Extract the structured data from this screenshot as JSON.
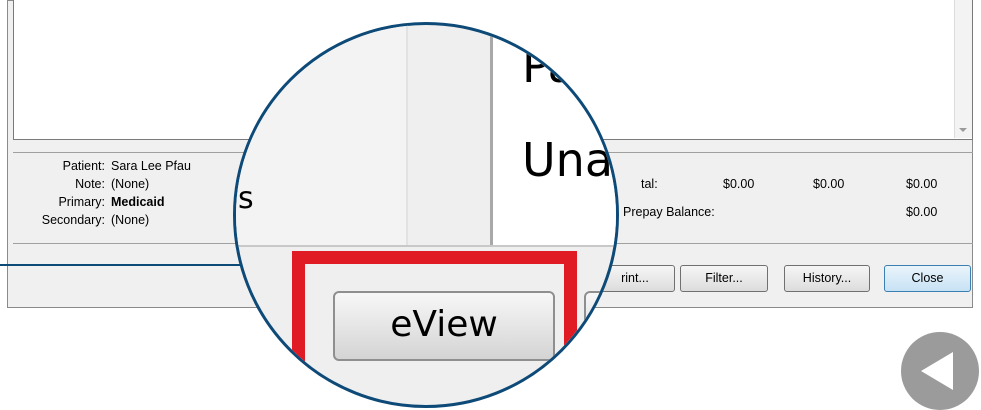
{
  "patient_panel": {
    "rows": [
      {
        "label": "Patient:",
        "value": "Sara Lee Pfau"
      },
      {
        "label": "Note:",
        "value": "(None)"
      },
      {
        "label": "Primary:",
        "value": "Medicaid"
      },
      {
        "label": "Secondary:",
        "value": "(None)"
      }
    ]
  },
  "totals": {
    "total_label": "tal:",
    "col1": "$0.00",
    "col2": "$0.00",
    "col3": "$0.00",
    "prepay_label": "Prepay Balance:",
    "prepay_value": "$0.00"
  },
  "buttons": {
    "print": "rint...",
    "filter": "Filter...",
    "history": "History...",
    "close": "Close"
  },
  "magnifier": {
    "text_top": "Pa",
    "text_mid": "Unap",
    "partial_letter": "s",
    "eview_button": "eView"
  },
  "colors": {
    "highlight": "#e01b24",
    "callout": "#0e4a78"
  },
  "icons": {
    "back": "back-arrow-icon"
  }
}
